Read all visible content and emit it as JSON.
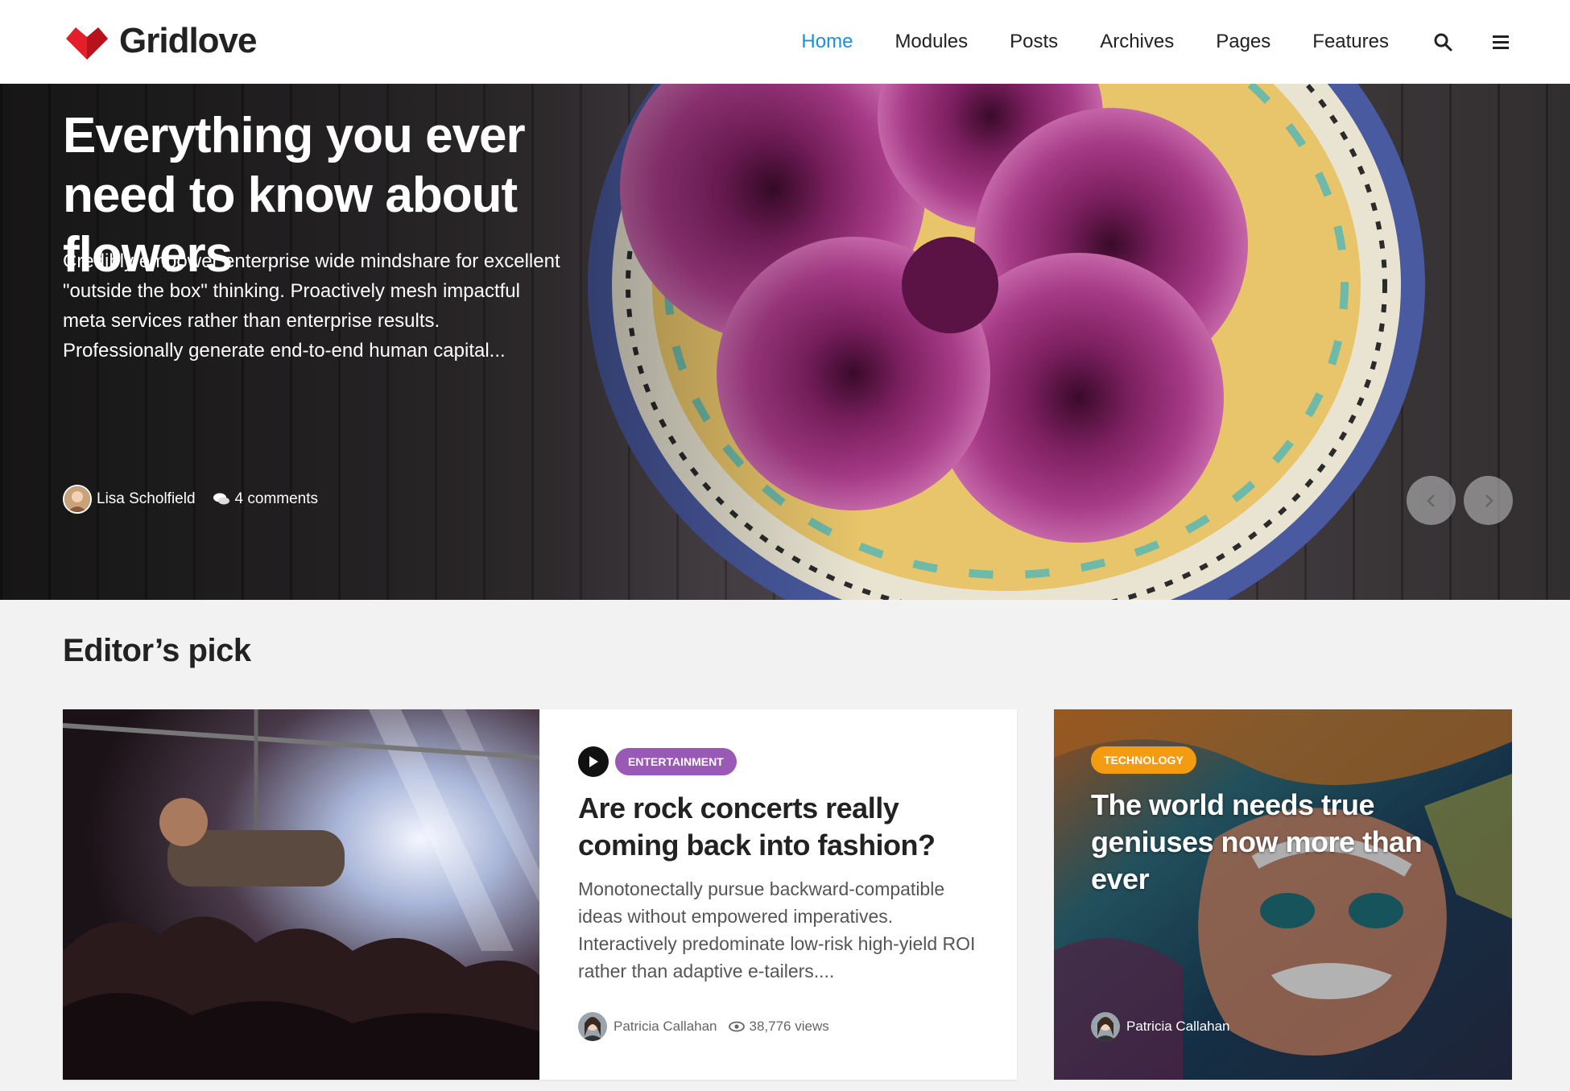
{
  "brand": {
    "name": "Gridlove",
    "accent": "#e41e2b"
  },
  "nav": {
    "items": [
      {
        "label": "Home",
        "active": true
      },
      {
        "label": "Modules"
      },
      {
        "label": "Posts"
      },
      {
        "label": "Archives"
      },
      {
        "label": "Pages"
      },
      {
        "label": "Features"
      }
    ],
    "active_color": "#1a8fe0",
    "icons": [
      "search-icon",
      "hamburger-menu-icon"
    ]
  },
  "hero": {
    "title": "Everything you ever need to know about flowers",
    "excerpt": "Credibly empower enterprise wide mindshare for excellent \"outside the box\" thinking. Proactively mesh impactful meta services rather than enterprise results. Professionally generate end-to-end human capital...",
    "author": "Lisa Scholfield",
    "comments": "4 comments",
    "icons": [
      "comments-icon",
      "chevron-left-icon",
      "chevron-right-icon"
    ]
  },
  "editors_pick": {
    "title": "Editor’s pick",
    "main_post": {
      "category": "ENTERTAINMENT",
      "category_color": "#9b59b6",
      "format_icon": "play-icon",
      "title": "Are rock concerts really coming back into fashion?",
      "excerpt": "Monotonectally pursue backward-compatible ideas without empowered imperatives. Interactively predominate low-risk high-yield ROI rather than adaptive e-tailers....",
      "author": "Patricia Callahan",
      "views": "38,776 views"
    },
    "side_post": {
      "category": "TECHNOLOGY",
      "category_color": "#f39c12",
      "title": "The world needs true geniuses now more than ever",
      "author": "Patricia Callahan"
    }
  }
}
